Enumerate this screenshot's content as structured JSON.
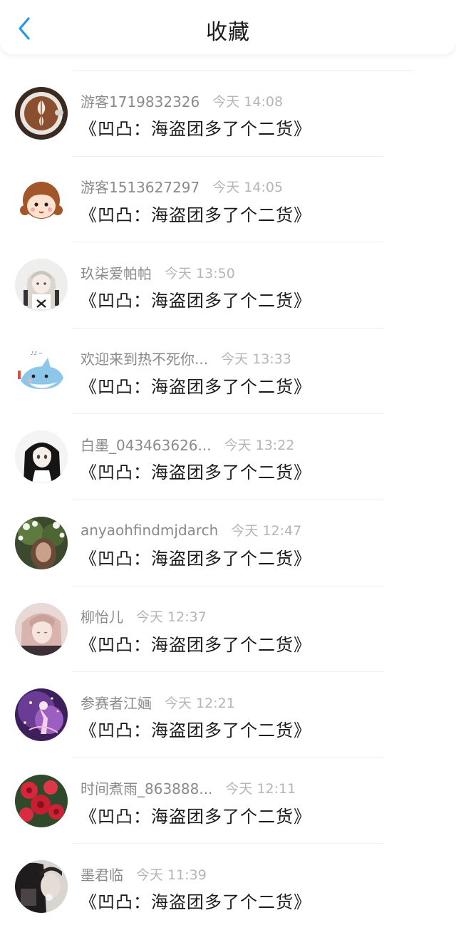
{
  "header": {
    "title": "收藏",
    "back_icon": "chevron-left-icon",
    "accent_color": "#2a96e8"
  },
  "items": [
    {
      "name": "游客1719832326",
      "time": "今天 14:08",
      "title": "《凹凸：海盗团多了个二货》",
      "avatar": "coffee-latte-art"
    },
    {
      "name": "游客1513627297",
      "time": "今天 14:05",
      "title": "《凹凸：海盗团多了个二货》",
      "avatar": "cartoon-girl"
    },
    {
      "name": "玖柒爱帕帕",
      "time": "今天 13:50",
      "title": "《凹凸：海盗团多了个二货》",
      "avatar": "anime-white-hair"
    },
    {
      "name": "欢迎来到热不死你...",
      "time": "今天 13:33",
      "title": "《凹凸：海盗团多了个二货》",
      "avatar": "cute-shark-sticker"
    },
    {
      "name": "白墨_043463626...",
      "time": "今天 13:22",
      "title": "《凹凸：海盗团多了个二货》",
      "avatar": "anime-black-hair"
    },
    {
      "name": "anyaohfindmjdarch",
      "time": "今天 12:47",
      "title": "《凹凸：海盗团多了个二货》",
      "avatar": "flowers-portrait"
    },
    {
      "name": "柳怡儿",
      "time": "今天 12:37",
      "title": "《凹凸：海盗团多了个二货》",
      "avatar": "pink-haired-anime"
    },
    {
      "name": "参赛者江婳",
      "time": "今天 12:21",
      "title": "《凹凸：海盗团多了个二货》",
      "avatar": "purple-galaxy-anime"
    },
    {
      "name": "时间煮雨_863888...",
      "time": "今天 12:11",
      "title": "《凹凸：海盗团多了个二货》",
      "avatar": "red-spider-lily"
    },
    {
      "name": "墨君临",
      "time": "今天 11:39",
      "title": "《凹凸：海盗团多了个二货》",
      "avatar": "dark-portrait"
    }
  ]
}
